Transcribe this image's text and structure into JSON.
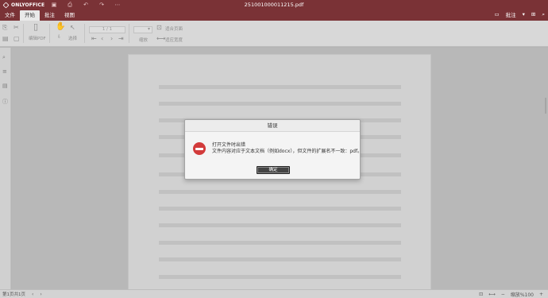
{
  "app": {
    "brand": "ONLYOFFICE",
    "doc_title": "251001000011215.pdf"
  },
  "title_bar": {
    "icons": [
      "save-icon",
      "print-icon",
      "undo-icon",
      "redo-icon",
      "more-icon"
    ]
  },
  "tabs": [
    {
      "label": "文件",
      "active": false
    },
    {
      "label": "开始",
      "active": true
    },
    {
      "label": "批注",
      "active": false
    },
    {
      "label": "视图",
      "active": false
    }
  ],
  "header_right": {
    "comments_label": "批注"
  },
  "toolbar": {
    "edit_pdf_label": "编辑PDF",
    "select_label": "选择",
    "page_input_value": "1 / 1",
    "zoom_label": "缩放",
    "fit_page_label": "适合页面",
    "fit_width_label": "适应宽度"
  },
  "status": {
    "page_info": "第1页共1页",
    "zoom_text": "缩放%100"
  },
  "dialog": {
    "title": "错误",
    "message_line1": "打开文件时出错",
    "message_line2": "文件内容对应于文本文档（例如docx），但文件的扩展名不一致：pdf。",
    "ok_label": "确定"
  },
  "colors": {
    "brand": "#7a3236",
    "error": "#d23b3b",
    "toolbar": "#d8d8d8",
    "canvas": "#b8b8b8"
  }
}
